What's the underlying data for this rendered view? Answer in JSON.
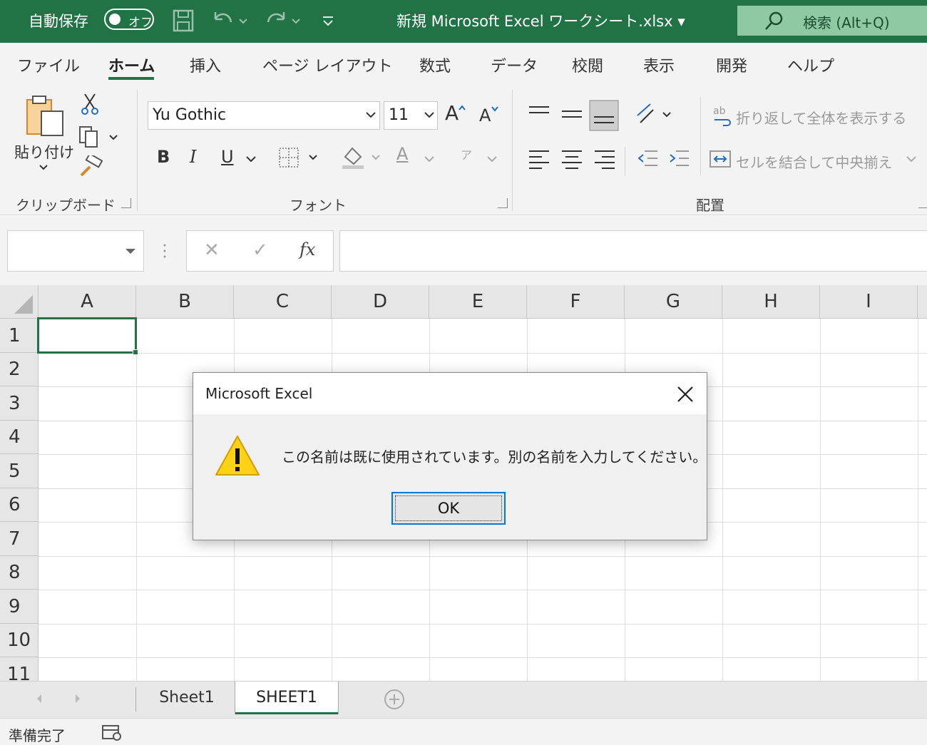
{
  "titlebar": {
    "autosave_label": "自動保存",
    "autosave_state": "オフ",
    "document_title": "新規 Microsoft Excel ワークシート.xlsx ▾",
    "search_label": "検索 (Alt+Q)",
    "bg_color": "#217346"
  },
  "ribbon_tabs": [
    "ファイル",
    "ホーム",
    "挿入",
    "ページ レイアウト",
    "数式",
    "データ",
    "校閲",
    "表示",
    "開発",
    "ヘルプ"
  ],
  "ribbon": {
    "clipboard": {
      "paste_label": "貼り付け",
      "group_label": "クリップボード"
    },
    "font": {
      "font_name": "Yu Gothic",
      "font_size": "11",
      "bold": "B",
      "italic": "I",
      "underline": "U",
      "grow": "A",
      "shrink": "A",
      "font_color": "A",
      "phonetic": "ア",
      "group_label": "フォント"
    },
    "alignment": {
      "wrap_text": "折り返して全体を表示する",
      "merge_center": "セルを結合して中央揃え",
      "group_label": "配置"
    }
  },
  "formula_bar": {
    "cancel": "✕",
    "enter": "✓",
    "fx": "fx",
    "formula_value": ""
  },
  "grid": {
    "columns": [
      "A",
      "B",
      "C",
      "D",
      "E",
      "F",
      "G",
      "H",
      "I"
    ],
    "rows": [
      "1",
      "2",
      "3",
      "4",
      "5",
      "6",
      "7",
      "8",
      "9",
      "10",
      "11"
    ],
    "selected_cell": "A1"
  },
  "sheets": [
    {
      "name": "Sheet1",
      "active": false
    },
    {
      "name": "SHEET1",
      "active": true
    }
  ],
  "status": {
    "text": "準備完了"
  },
  "dialog": {
    "title": "Microsoft Excel",
    "message": "この名前は既に使用されています。別の名前を入力してください。",
    "ok_label": "OK",
    "icon": "warning-icon"
  }
}
